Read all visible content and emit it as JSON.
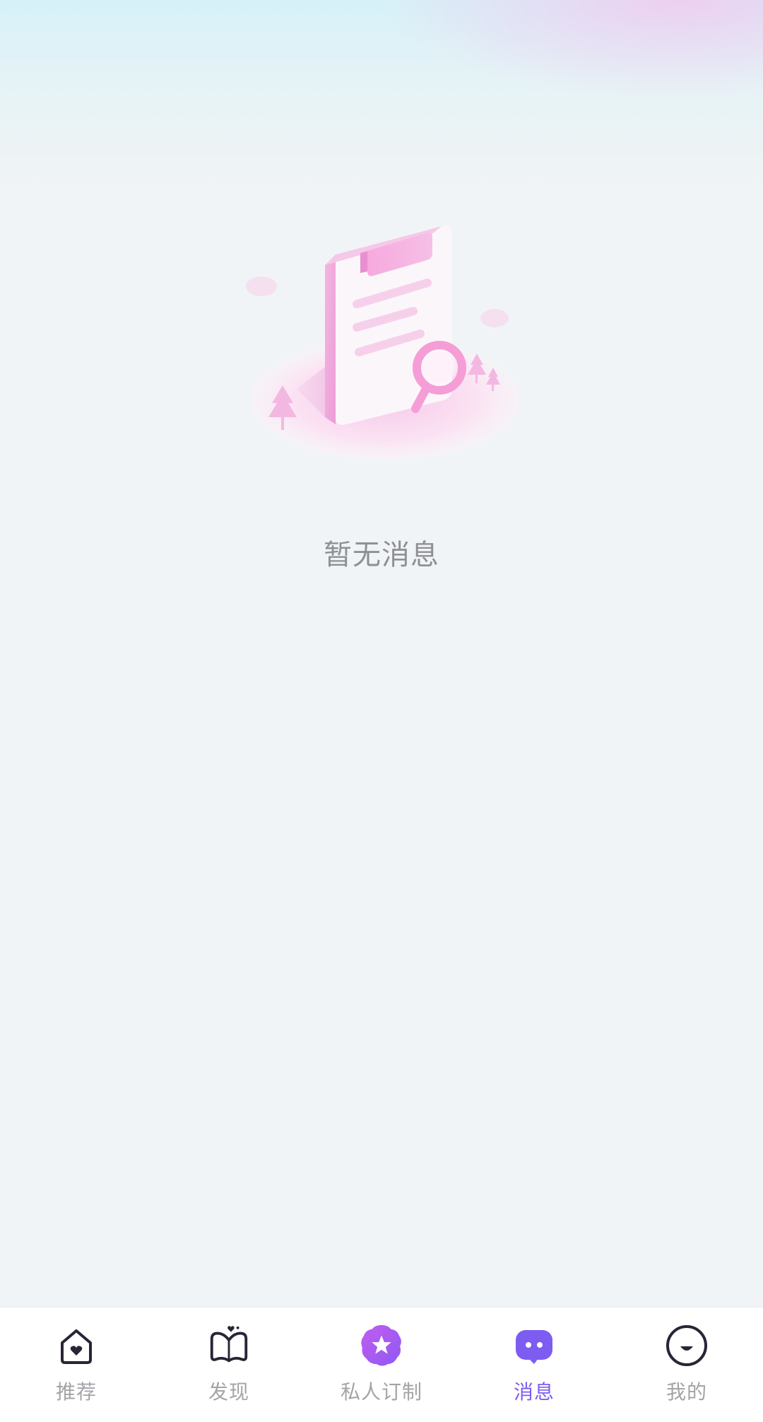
{
  "empty_state": {
    "message": "暂无消息",
    "illustration_icon": "clipboard-search-illustration"
  },
  "tabbar": {
    "active_index": 3,
    "accent_color": "#7d5cf2",
    "items": [
      {
        "label": "推荐",
        "icon": "home-heart-icon"
      },
      {
        "label": "发现",
        "icon": "discover-heart-icon"
      },
      {
        "label": "私人订制",
        "icon": "star-badge-icon"
      },
      {
        "label": "消息",
        "icon": "chat-bubble-icon"
      },
      {
        "label": "我的",
        "icon": "smiley-face-icon"
      }
    ]
  }
}
